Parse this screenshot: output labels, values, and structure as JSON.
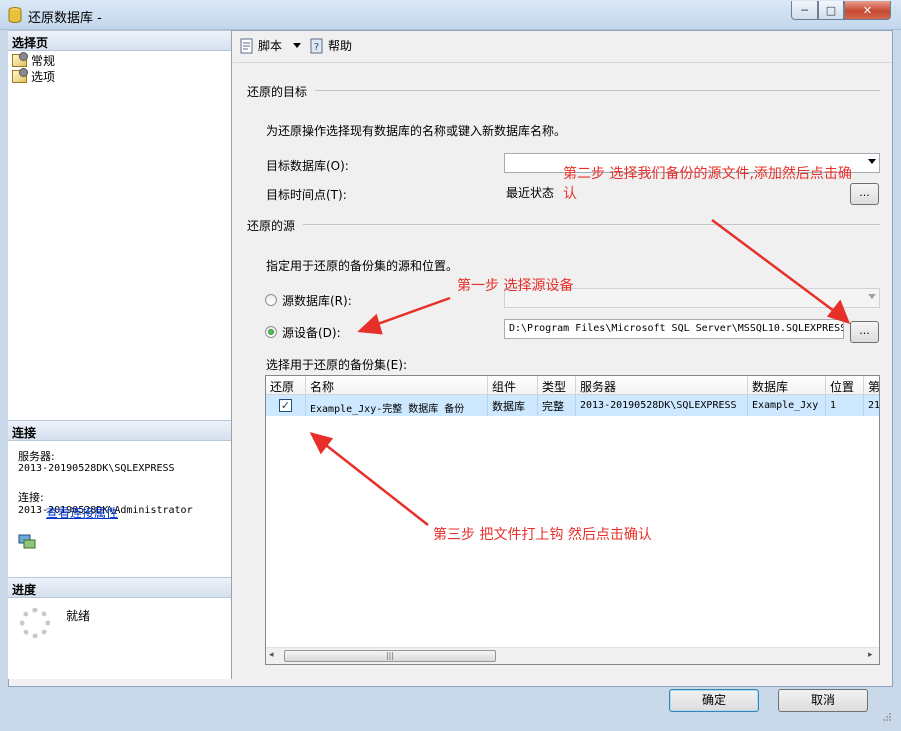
{
  "window": {
    "title": "还原数据库 -",
    "close_glyph": "✕",
    "minimize_glyph": "─",
    "maximize_glyph": "□"
  },
  "left_pane": {
    "select_page_header": "选择页",
    "pages": [
      {
        "label": "常规",
        "icon": "page-icon"
      },
      {
        "label": "选项",
        "icon": "page-icon"
      }
    ],
    "connection_header": "连接",
    "server_label": "服务器:",
    "server_value": "2013-20190528DK\\SQLEXPRESS",
    "connection_label": "连接:",
    "connection_value": "2013-20190528DK\\Administrator",
    "view_connection_link": "查看连接属性",
    "progress_header": "进度",
    "progress_status": "就绪"
  },
  "toolbar": {
    "script_label": "脚本",
    "help_label": "帮助"
  },
  "restore_target": {
    "section_title": "还原的目标",
    "description": "为还原操作选择现有数据库的名称或键入新数据库名称。",
    "target_db_label": "目标数据库(O):",
    "target_db_value": "",
    "target_time_label": "目标时间点(T):",
    "target_time_value": "最近状态"
  },
  "restore_source": {
    "section_title": "还原的源",
    "description": "指定用于还原的备份集的源和位置。",
    "source_db_label": "源数据库(R):",
    "source_device_label": "源设备(D):",
    "source_device_value": "D:\\Program Files\\Microsoft SQL Server\\MSSQL10.SQLEXPRESS",
    "selected_option": "source_device",
    "browse_label": "...",
    "backup_sets_label": "选择用于还原的备份集(E):"
  },
  "grid": {
    "columns": [
      "还原",
      "名称",
      "组件",
      "类型",
      "服务器",
      "数据库",
      "位置",
      "第"
    ],
    "rows": [
      {
        "restore": true,
        "name": "Example_Jxy-完整 数据库 备份",
        "component": "数据库",
        "type": "完整",
        "server": "2013-20190528DK\\SQLEXPRESS",
        "database": "Example_Jxy",
        "position": "1",
        "first": "21"
      }
    ],
    "scroll_thumb_glyph": "|||",
    "scroll_left_glyph": "◂",
    "scroll_right_glyph": "▸"
  },
  "buttons": {
    "ok": "确定",
    "cancel": "取消"
  },
  "annotations": {
    "step1": "第一步  选择源设备",
    "step2_line1": "第二步  选择我们备份的源文件,添加然后点击确",
    "step2_line2": "认",
    "step3": "第三步  把文件打上钩  然后点击确认",
    "color": "#e8302a"
  }
}
